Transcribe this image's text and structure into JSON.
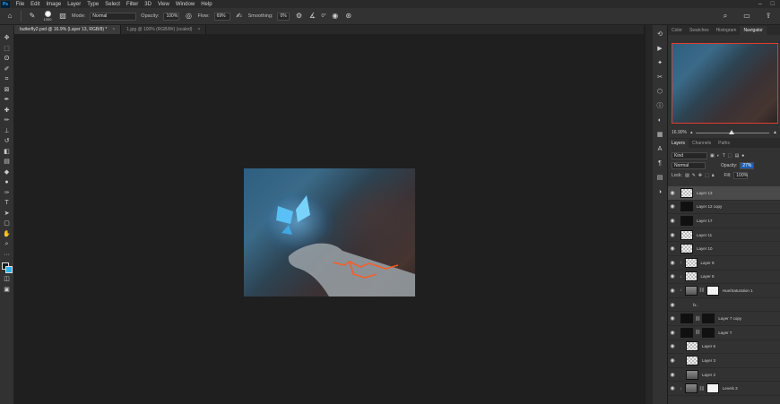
{
  "menubar": {
    "logo": "Ps",
    "items": [
      "File",
      "Edit",
      "Image",
      "Layer",
      "Type",
      "Select",
      "Filter",
      "3D",
      "View",
      "Window",
      "Help"
    ]
  },
  "options": {
    "brush_size": "1000",
    "mode_label": "Mode:",
    "mode_value": "Normal",
    "opacity_label": "Opacity:",
    "opacity_value": "100%",
    "flow_label": "Flow:",
    "flow_value": "69%",
    "smoothing_label": "Smoothing:",
    "smoothing_value": "0%",
    "angle_value": "0°"
  },
  "tabs": [
    {
      "label": "butterfly2.psd @ 16.9% (Layer 13, RGB/8) *",
      "active": true
    },
    {
      "label": "1.jpg @ 100% (RGB/8#) (scaled)",
      "active": false
    }
  ],
  "nav_panel": {
    "tabs": [
      "Color",
      "Swatches",
      "Histogram",
      "Navigator"
    ],
    "active_tab": "Navigator",
    "zoom": "16.90%"
  },
  "layers_panel": {
    "tabs": [
      "Layers",
      "Channels",
      "Paths"
    ],
    "active_tab": "Layers",
    "filter_kind": "Kind",
    "blend_mode": "Normal",
    "opacity_label": "Opacity:",
    "opacity_value": "27%",
    "lock_label": "Lock:",
    "fill_label": "Fill:",
    "fill_value": "100%",
    "layers": [
      {
        "name": "Layer 13",
        "thumb": "checker",
        "selected": true
      },
      {
        "name": "Layer 12 copy",
        "thumb": "checker"
      },
      {
        "name": "Layer 17",
        "thumb": "dark"
      },
      {
        "name": "Layer 11",
        "thumb": "checker"
      },
      {
        "name": "Layer 10",
        "thumb": "checker"
      },
      {
        "name": "Layer 9",
        "thumb": "checker",
        "clipped": true
      },
      {
        "name": "Layer 8",
        "thumb": "checker",
        "clipped": true
      },
      {
        "name": "Hue/Saturation 1",
        "thumb": "gray",
        "clipped": true,
        "mask": "white"
      },
      {
        "name": "fx..",
        "thumb": "none"
      },
      {
        "name": "Layer 7 copy",
        "thumb": "dark",
        "mask": "dark"
      },
      {
        "name": "Layer 7",
        "thumb": "dark",
        "mask": "dark"
      },
      {
        "name": "Layer 6",
        "thumb": "checker",
        "clipped": true
      },
      {
        "name": "Layer 3",
        "thumb": "checker",
        "clipped": true
      },
      {
        "name": "Layer 2",
        "thumb": "gray",
        "clipped": true
      },
      {
        "name": "Levels 3",
        "thumb": "gray",
        "clipped": true,
        "mask": "white"
      }
    ]
  },
  "colors": {
    "accent": "#1f5fb0",
    "navigator_box": "#e33b2e",
    "background_swatch": "#29b5e8"
  }
}
